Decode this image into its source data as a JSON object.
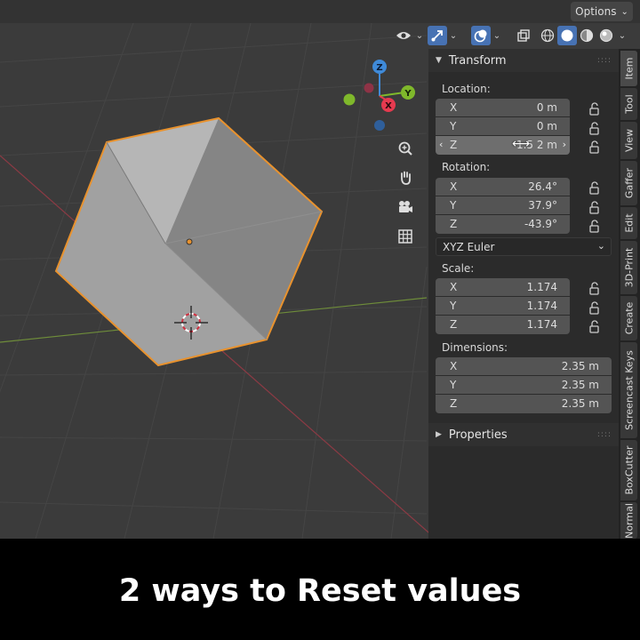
{
  "header": {
    "options_label": "Options"
  },
  "viewport": {
    "gizmo": {
      "z": "Z",
      "y": "Y",
      "x": "X"
    }
  },
  "npanel": {
    "transform_title": "Transform",
    "location": {
      "label": "Location:",
      "rows": [
        {
          "axis": "X",
          "value": "0 m"
        },
        {
          "axis": "Y",
          "value": "0 m"
        },
        {
          "axis": "Z",
          "value": "1.5  2 m"
        }
      ]
    },
    "rotation": {
      "label": "Rotation:",
      "rows": [
        {
          "axis": "X",
          "value": "26.4°"
        },
        {
          "axis": "Y",
          "value": "37.9°"
        },
        {
          "axis": "Z",
          "value": "-43.9°"
        }
      ]
    },
    "rotation_mode": "XYZ Euler",
    "scale": {
      "label": "Scale:",
      "rows": [
        {
          "axis": "X",
          "value": "1.174"
        },
        {
          "axis": "Y",
          "value": "1.174"
        },
        {
          "axis": "Z",
          "value": "1.174"
        }
      ]
    },
    "dimensions": {
      "label": "Dimensions:",
      "rows": [
        {
          "axis": "X",
          "value": "2.35 m"
        },
        {
          "axis": "Y",
          "value": "2.35 m"
        },
        {
          "axis": "Z",
          "value": "2.35 m"
        }
      ]
    },
    "properties_title": "Properties"
  },
  "tabs": [
    "Item",
    "Tool",
    "View",
    "Gaffer",
    "Edit",
    "3D-Print",
    "Create",
    "Screencast Keys",
    "BoxCutter",
    "Normal"
  ],
  "caption": "2 ways to Reset values",
  "colors": {
    "selection_outline": "#e8922e",
    "accent_blue": "#4772b3",
    "axis_x": "#e63a4f",
    "axis_y": "#7fb82b",
    "axis_z": "#3f8ad8"
  }
}
